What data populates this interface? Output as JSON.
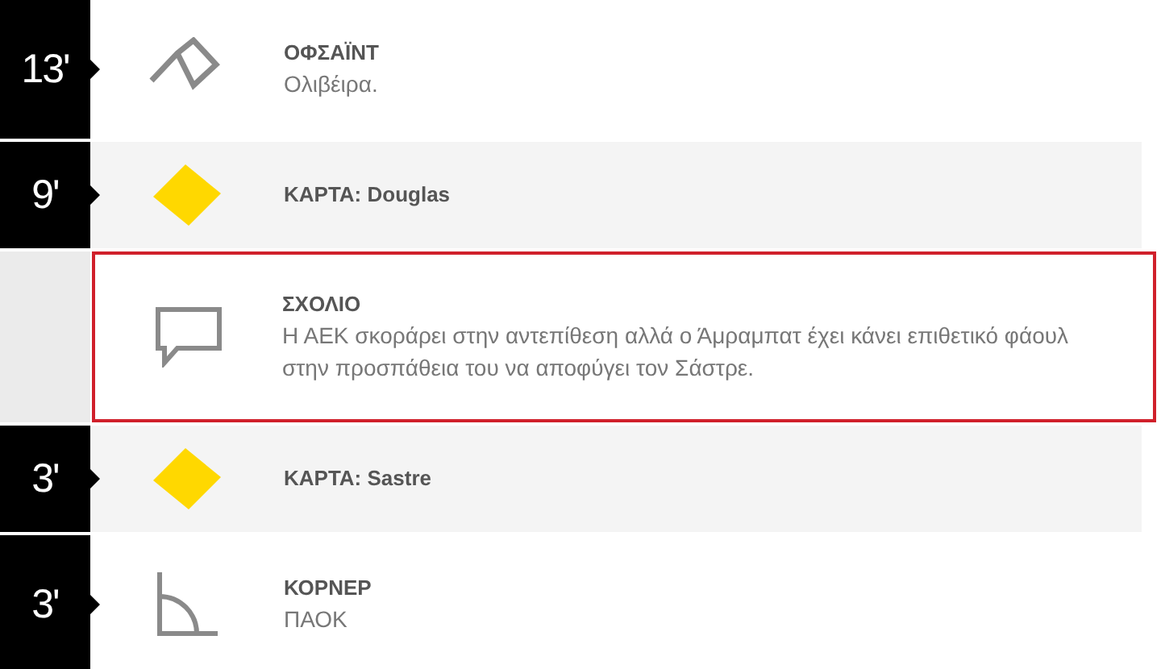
{
  "events": [
    {
      "kind": "offside",
      "minute": "13'",
      "title": "ΟΦΣΑΪΝΤ",
      "detail": "Ολιβέιρα.",
      "highlighted": false
    },
    {
      "kind": "card",
      "minute": "9'",
      "title": "ΚΑΡΤΑ: Douglas",
      "highlighted": false
    },
    {
      "kind": "comment",
      "title": "ΣΧΟΛΙΟ",
      "detail": "Η ΑΕΚ σκοράρει στην αντεπίθεση αλλά ο Άμραμπατ έχει κάνει επιθετικό φάουλ στην προσπάθεια του να αποφύγει τον Σάστρε.",
      "highlighted": true
    },
    {
      "kind": "card",
      "minute": "3'",
      "title": "ΚΑΡΤΑ: Sastre",
      "highlighted": false
    },
    {
      "kind": "corner",
      "minute": "3'",
      "title": "ΚΟΡΝΕΡ",
      "detail": "ΠΑΟΚ",
      "highlighted": false
    }
  ]
}
